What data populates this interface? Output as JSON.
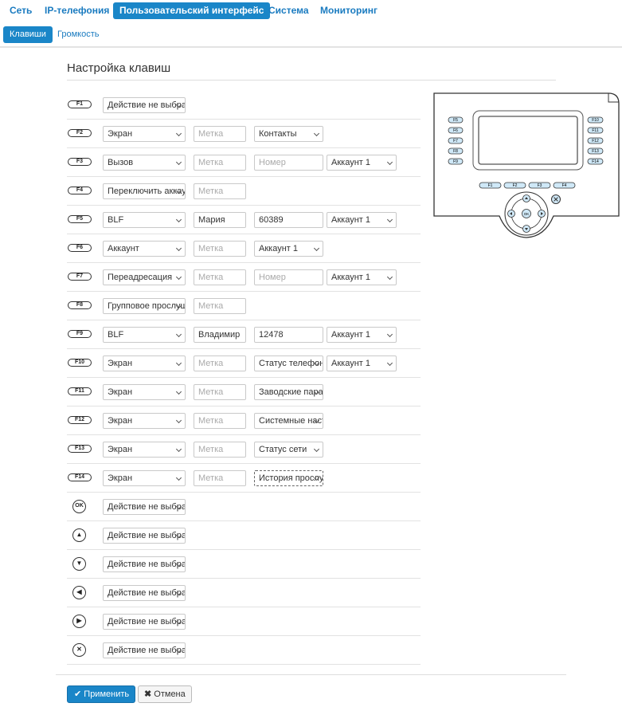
{
  "top_nav": [
    "Сеть",
    "IP-телефония",
    "Пользовательский интерфейс",
    "Система",
    "Мониторинг"
  ],
  "top_nav_active": 2,
  "sub_nav": [
    "Клавиши",
    "Громкость"
  ],
  "sub_nav_active": 0,
  "page_title": "Настройка клавиш",
  "placeholders": {
    "label": "Метка",
    "number": "Номер"
  },
  "rows": [
    {
      "key": "F1",
      "action": "Действие не выбрано"
    },
    {
      "key": "F2",
      "action": "Экран",
      "label": "",
      "param": "Контакты",
      "param_type": "select"
    },
    {
      "key": "F3",
      "action": "Вызов",
      "label": "",
      "param": "",
      "param_type": "input",
      "account": "Аккаунт 1"
    },
    {
      "key": "F4",
      "action": "Переключить аккаунт",
      "label": ""
    },
    {
      "key": "F5",
      "action": "BLF",
      "label": "Мария",
      "param": "60389",
      "param_type": "input",
      "account": "Аккаунт 1"
    },
    {
      "key": "F6",
      "action": "Аккаунт",
      "label": "",
      "param": "Аккаунт 1",
      "param_type": "select"
    },
    {
      "key": "F7",
      "action": "Переадресация",
      "label": "",
      "param": "",
      "param_type": "input",
      "account": "Аккаунт 1"
    },
    {
      "key": "F8",
      "action": "Групповое прослушивание",
      "label": ""
    },
    {
      "key": "F9",
      "action": "BLF",
      "label": "Владимир",
      "param": "12478",
      "param_type": "input",
      "account": "Аккаунт 1"
    },
    {
      "key": "F10",
      "action": "Экран",
      "label": "",
      "param": "Статус телефона",
      "param_type": "select",
      "account": "Аккаунт 1"
    },
    {
      "key": "F11",
      "action": "Экран",
      "label": "",
      "param": "Заводские параметры",
      "param_type": "select"
    },
    {
      "key": "F12",
      "action": "Экран",
      "label": "",
      "param": "Системные настройки",
      "param_type": "select"
    },
    {
      "key": "F13",
      "action": "Экран",
      "label": "",
      "param": "Статус сети",
      "param_type": "select"
    },
    {
      "key": "F14",
      "action": "Экран",
      "label": "",
      "param": "История прослушивания",
      "param_type": "select",
      "focused": true
    },
    {
      "key": "OK",
      "icon": "ok-icon",
      "action": "Действие не выбрано"
    },
    {
      "key": "up",
      "icon": "arrow-up-icon",
      "action": "Действие не выбрано"
    },
    {
      "key": "down",
      "icon": "arrow-down-icon",
      "action": "Действие не выбрано"
    },
    {
      "key": "left",
      "icon": "arrow-left-icon",
      "action": "Действие не выбрано"
    },
    {
      "key": "right",
      "icon": "arrow-right-icon",
      "action": "Действие не выбрано"
    },
    {
      "key": "cancel",
      "icon": "close-icon",
      "action": "Действие не выбрано"
    }
  ],
  "phone_diagram": {
    "left_keys": [
      "F5",
      "F6",
      "F7",
      "F8",
      "F9"
    ],
    "right_keys": [
      "F10",
      "F11",
      "F12",
      "F13",
      "F14"
    ],
    "bottom_keys": [
      "F1",
      "F2",
      "F3",
      "F4"
    ],
    "ok_label": "OK"
  },
  "buttons": {
    "apply": "Применить",
    "cancel": "Отмена"
  },
  "colors": {
    "accent": "#1a86c8",
    "key_fill": "#cfe8f7"
  }
}
